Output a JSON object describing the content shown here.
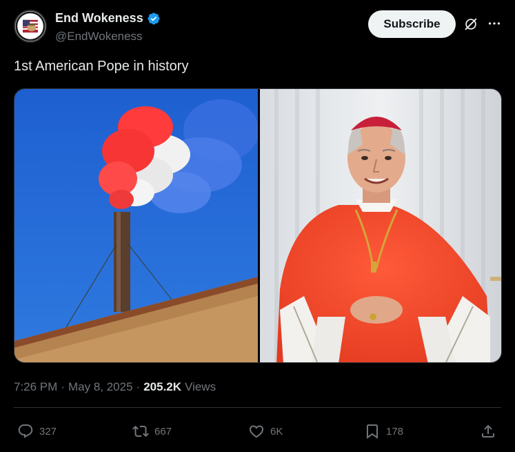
{
  "author": {
    "display_name": "End Wokeness",
    "handle": "@EndWokeness",
    "avatar_text": "I SUPPORT THE ARMED FORCES"
  },
  "header": {
    "subscribe_label": "Subscribe",
    "grok_icon": "grok-icon",
    "more_icon": "more-horizontal-icon"
  },
  "tweet": {
    "text": "1st American Pope in history"
  },
  "meta": {
    "time": "7:26 PM",
    "separator_1": "·",
    "date": "May 8, 2025",
    "separator_2": "·",
    "views_count": "205.2K",
    "views_label": "Views"
  },
  "actions": {
    "replies": "327",
    "reposts": "667",
    "likes": "6K",
    "bookmarks": "178"
  },
  "colors": {
    "background": "#000000",
    "text_primary": "#e7e9ea",
    "text_secondary": "#71767b",
    "verified_blue": "#1d9bf0",
    "button_bg": "#eff3f4",
    "border": "#2f3336"
  }
}
